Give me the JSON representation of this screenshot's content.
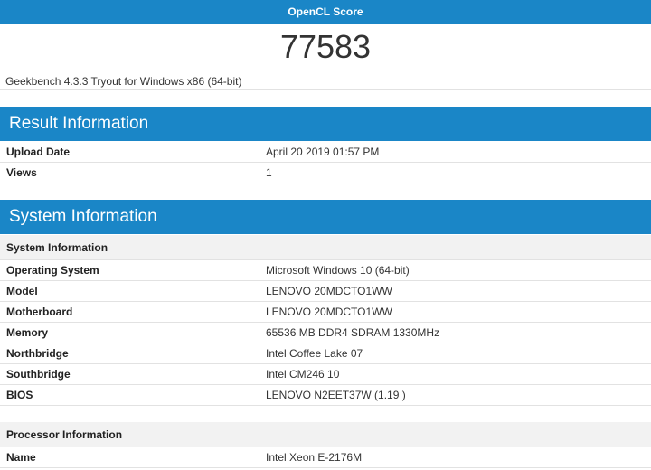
{
  "score": {
    "header": "OpenCL Score",
    "value": "77583",
    "subtitle": "Geekbench 4.3.3 Tryout for Windows x86 (64-bit)"
  },
  "result_information": {
    "title": "Result Information",
    "rows": [
      {
        "label": "Upload Date",
        "value": "April 20 2019 01:57 PM"
      },
      {
        "label": "Views",
        "value": "1"
      }
    ]
  },
  "system_information": {
    "title": "System Information",
    "system_subheader": "System Information",
    "system_rows": [
      {
        "label": "Operating System",
        "value": "Microsoft Windows 10 (64-bit)"
      },
      {
        "label": "Model",
        "value": "LENOVO 20MDCTO1WW"
      },
      {
        "label": "Motherboard",
        "value": "LENOVO 20MDCTO1WW"
      },
      {
        "label": "Memory",
        "value": "65536 MB DDR4 SDRAM 1330MHz"
      },
      {
        "label": "Northbridge",
        "value": "Intel Coffee Lake 07"
      },
      {
        "label": "Southbridge",
        "value": "Intel CM246 10"
      },
      {
        "label": "BIOS",
        "value": "LENOVO N2EET37W (1.19 )"
      }
    ],
    "processor_subheader": "Processor Information",
    "processor_rows": [
      {
        "label": "Name",
        "value": "Intel Xeon E-2176M"
      }
    ]
  }
}
